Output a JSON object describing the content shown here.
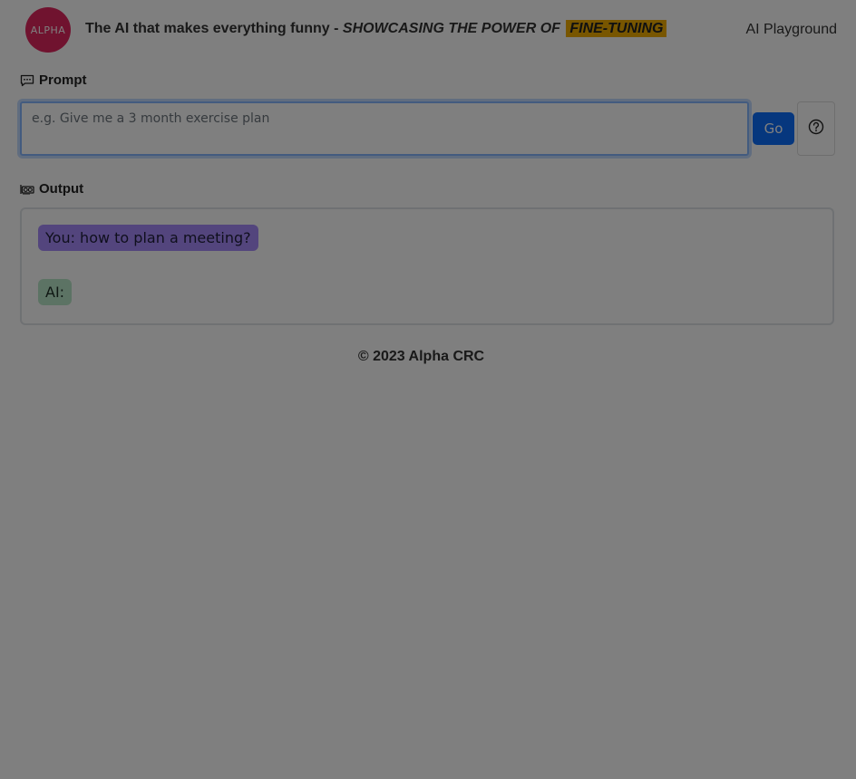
{
  "header": {
    "logo_text": "ALPHA",
    "title": "The AI that makes everything funny",
    "separator": " - ",
    "tagline": "SHOWCASING THE POWER OF",
    "highlight": "FINE-TUNING",
    "nav_link": "AI Playground"
  },
  "prompt": {
    "label": "Prompt",
    "placeholder": "e.g. Give me a 3 month exercise plan",
    "value": "",
    "go_label": "Go",
    "help_icon": "question-circle-icon"
  },
  "output": {
    "label": "Output",
    "messages": [
      {
        "role": "user",
        "text": "You: how to plan a meeting?"
      },
      {
        "role": "ai",
        "text": "AI:"
      }
    ]
  },
  "footer": {
    "text": "© 2023 Alpha CRC"
  },
  "colors": {
    "logo": "#e0265f",
    "highlight": "#f0ad00",
    "primary": "#0d6efd",
    "user_bubble": "#a78bfa",
    "ai_bubble": "#b9e6c9",
    "backdrop": "rgba(0,0,0,0.5)"
  }
}
